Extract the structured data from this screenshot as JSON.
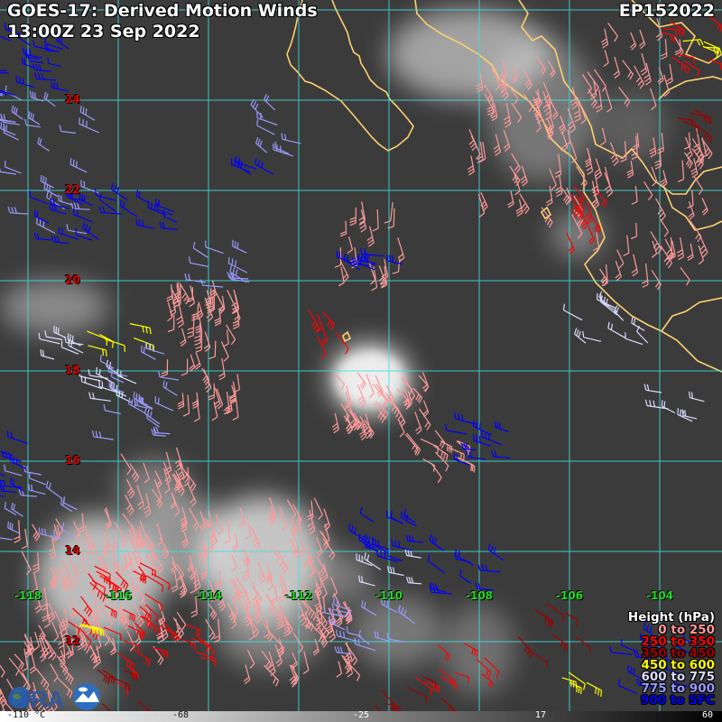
{
  "header": {
    "title": "GOES-17: Derived Motion Winds",
    "datetime": "13:00Z 23 Sep 2022",
    "storm_id": "EP152022"
  },
  "latitude_labels": [
    "24",
    "22",
    "20",
    "18",
    "16",
    "14",
    "12"
  ],
  "longitude_labels": [
    "-118",
    "-116",
    "-114",
    "-112",
    "-110",
    "-108",
    "-106",
    "-104"
  ],
  "legend": {
    "title": "Height (hPa)",
    "items": [
      {
        "label": "0 to 250",
        "color": "#ff9a9a"
      },
      {
        "label": "250 to 350",
        "color": "#ff0000"
      },
      {
        "label": "350 to 450",
        "color": "#a00000"
      },
      {
        "label": "450 to 600",
        "color": "#ffff00"
      },
      {
        "label": "600 to 775",
        "color": "#dcdcff"
      },
      {
        "label": "775 to 900",
        "color": "#9a9aff"
      },
      {
        "label": "900 to SFC",
        "color": "#0000ff"
      }
    ]
  },
  "colorbar": {
    "ticks": [
      "-110 °C",
      "-68",
      "-25",
      "17",
      "60"
    ]
  },
  "logo": {
    "text": "CIRA",
    "sub": "RAMMB"
  },
  "colors": {
    "grid": "#40e0e0",
    "coast": "#ffd070",
    "background": "#3b3b3b"
  }
}
